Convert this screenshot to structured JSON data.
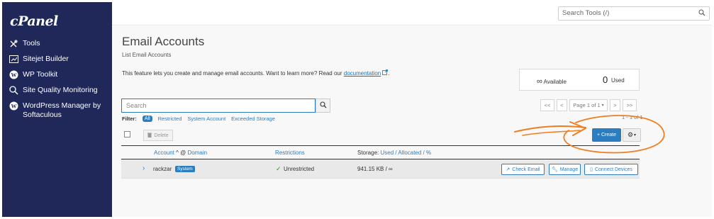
{
  "brand": {
    "logo_text": "cPanel"
  },
  "sidebar": {
    "items": [
      {
        "label": "Tools",
        "icon": "tools-icon"
      },
      {
        "label": "Sitejet Builder",
        "icon": "sitejet-icon"
      },
      {
        "label": "WP Toolkit",
        "icon": "wordpress-icon"
      },
      {
        "label": "Site Quality Monitoring",
        "icon": "magnify-icon"
      },
      {
        "label": "WordPress Manager by Softaculous",
        "icon": "wordpress-icon"
      }
    ]
  },
  "topbar": {
    "search_placeholder": "Search Tools (/)"
  },
  "page": {
    "title": "Email Accounts",
    "subtitle": "List Email Accounts",
    "intro_text": "This feature lets you create and manage email accounts. Want to learn more? Read our ",
    "intro_link": "documentation",
    "intro_end": "."
  },
  "stats": {
    "available_symbol": "∞",
    "available_label": "Available",
    "used_count": "0",
    "used_label": "Used"
  },
  "search": {
    "placeholder": "Search"
  },
  "filter": {
    "label": "Filter:",
    "options": [
      "All",
      "Restricted",
      "System Account",
      "Exceeded Storage"
    ],
    "selected": "All"
  },
  "pagination": {
    "first": "<<",
    "prev": "<",
    "page_label": "Page 1 of 1",
    "next": ">",
    "last": ">>",
    "count_text": "1 - 1 of 1"
  },
  "actions": {
    "delete_label": "Delete",
    "create_label": "+ Create"
  },
  "table": {
    "headers": {
      "account": "Account",
      "at": "@",
      "domain": "Domain",
      "restrictions": "Restrictions",
      "storage": "Storage:",
      "used": "Used",
      "slash1": "/",
      "allocated": "Allocated",
      "slash2": "/",
      "percent": "%"
    },
    "rows": [
      {
        "account": "rackzar",
        "badge": "System",
        "restriction": "Unrestricted",
        "storage": "941.15 KB / ∞",
        "btn_check": "Check Email",
        "btn_manage": "Manage",
        "btn_connect": "Connect Devices"
      }
    ]
  },
  "colors": {
    "sidebar_bg": "#1f2858",
    "accent": "#2c7dbf",
    "annotation": "#f07d1e",
    "success": "#3c8a2e"
  }
}
